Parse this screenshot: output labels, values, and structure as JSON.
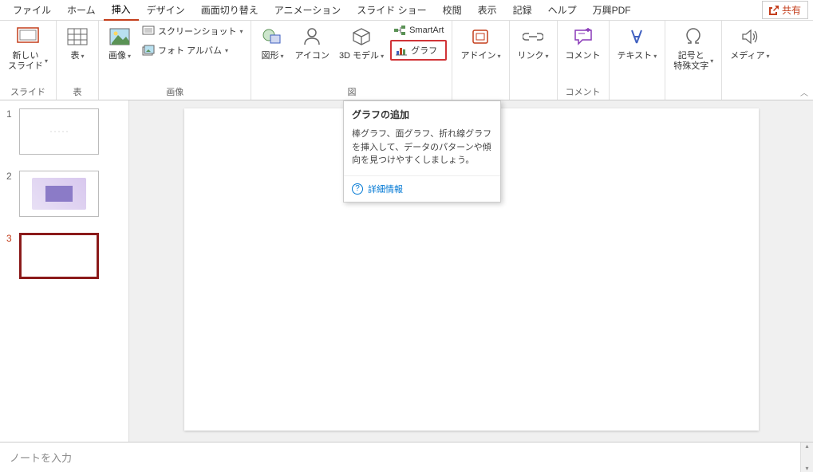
{
  "tabs": {
    "file": "ファイル",
    "home": "ホーム",
    "insert": "挿入",
    "design": "デザイン",
    "transitions": "画面切り替え",
    "animations": "アニメーション",
    "slideshow": "スライド ショー",
    "review": "校閲",
    "view": "表示",
    "record": "記録",
    "help": "ヘルプ",
    "wanxing": "万興PDF"
  },
  "share": "共有",
  "ribbon": {
    "newSlide": "新しい\nスライド",
    "table": "表",
    "image": "画像",
    "screenshot": "スクリーンショット",
    "photoAlbum": "フォト アルバム",
    "shapes": "図形",
    "icons": "アイコン",
    "model3d": "3D モデル",
    "smartart": "SmartArt",
    "chart": "グラフ",
    "addins": "アドイン",
    "link": "リンク",
    "comment": "コメント",
    "text": "テキスト",
    "symbols": "記号と\n特殊文字",
    "media": "メディア"
  },
  "groups": {
    "slides": "スライド",
    "tables": "表",
    "images": "画像",
    "illustrations": "図",
    "comments": "コメント"
  },
  "slides": {
    "s1": "1",
    "s2": "2",
    "s3": "3"
  },
  "tooltip": {
    "title": "グラフの追加",
    "body": "棒グラフ、面グラフ、折れ線グラフを挿入して、データのパターンや傾向を見つけやすくしましょう。",
    "more": "詳細情報"
  },
  "notes": {
    "placeholder": "ノートを入力"
  }
}
